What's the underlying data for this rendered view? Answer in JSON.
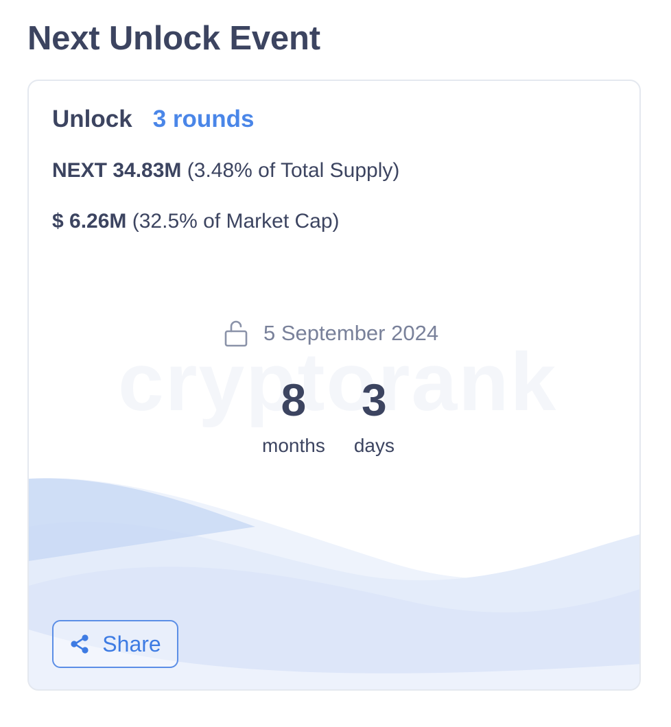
{
  "page": {
    "title": "Next Unlock Event"
  },
  "card": {
    "header_label": "Unlock",
    "rounds_link": "3 rounds",
    "supply": {
      "amount": "NEXT 34.83M",
      "detail": "(3.48% of Total Supply)"
    },
    "market_cap": {
      "amount": "$ 6.26M",
      "detail": "(32.5% of Market Cap)"
    },
    "watermark": "cryptorank",
    "date": "5 September 2024",
    "countdown": [
      {
        "value": "8",
        "label": "months"
      },
      {
        "value": "3",
        "label": "days"
      }
    ],
    "share_label": "Share"
  },
  "icons": {
    "date": "lock-open-icon",
    "share": "share-icon"
  },
  "colors": {
    "accent": "#4a86e8",
    "text": "#3c4460",
    "muted": "#79819a",
    "wave": "#c9d9f5"
  }
}
